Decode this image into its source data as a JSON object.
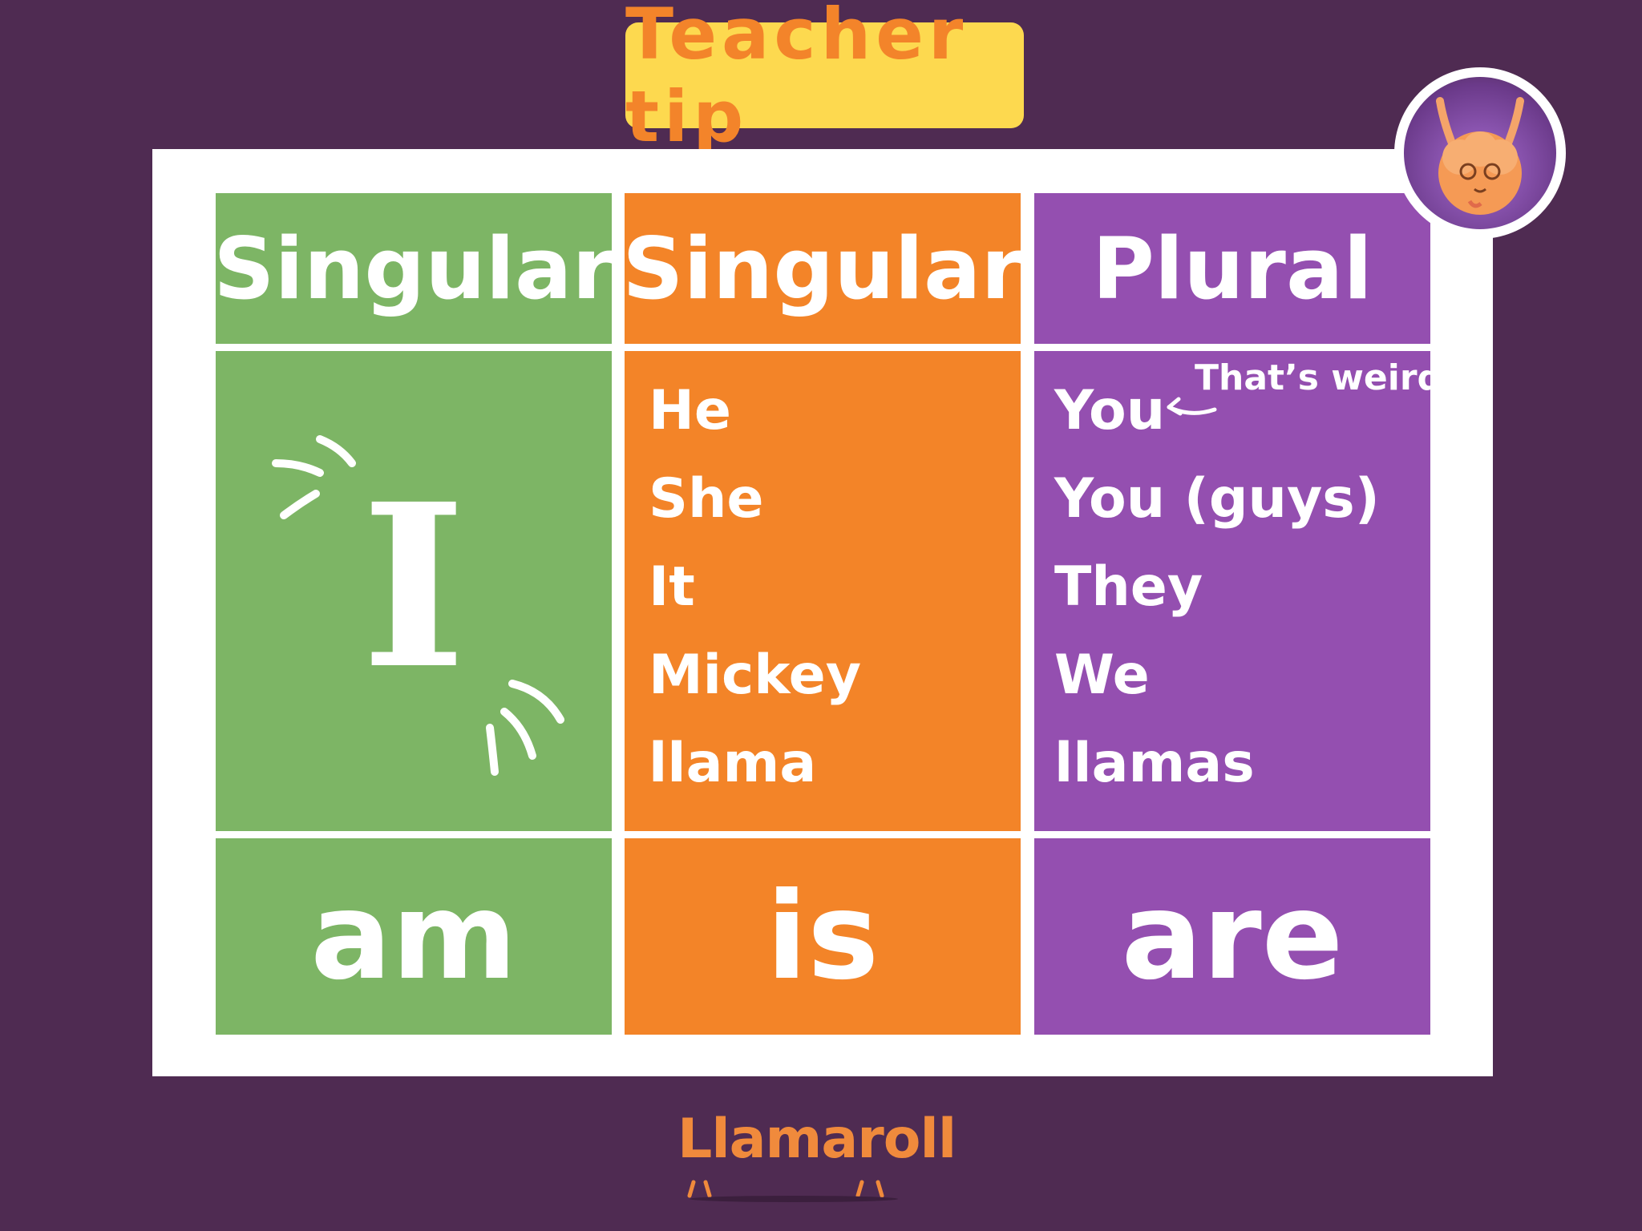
{
  "header": {
    "badge_text": "Teacher tip"
  },
  "table": {
    "columns": [
      {
        "heading": "Singular",
        "color": "#7db565",
        "main_word": "I",
        "verb": "am"
      },
      {
        "heading": "Singular",
        "color": "#f38428",
        "subjects": [
          "He",
          "She",
          "It",
          "Mickey",
          "llama"
        ],
        "verb": "is"
      },
      {
        "heading": "Plural",
        "color": "#944fb0",
        "subjects": [
          "You",
          "You (guys)",
          "They",
          "We",
          "llamas"
        ],
        "note": "That’s weird",
        "verb": "are"
      }
    ]
  },
  "brand": {
    "logo_text": "Llamaroll"
  },
  "colors": {
    "background": "#4f2b52",
    "badge": "#fdd94f",
    "badge_text": "#f3842a"
  }
}
